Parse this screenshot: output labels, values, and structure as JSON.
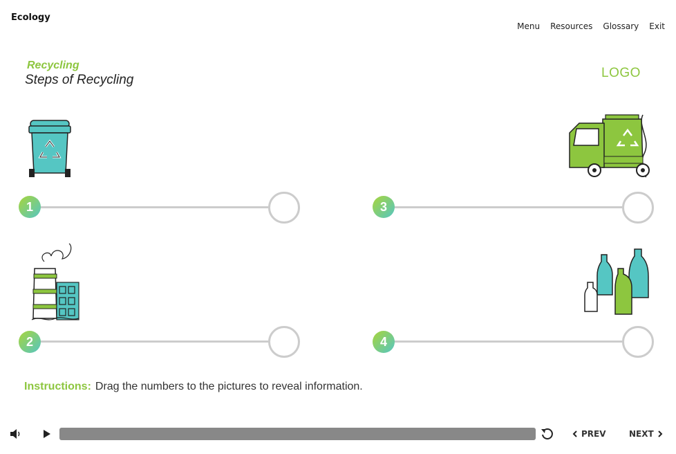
{
  "header": {
    "course_title": "Ecology",
    "nav": [
      "Menu",
      "Resources",
      "Glossary",
      "Exit"
    ]
  },
  "slide": {
    "kicker": "Recycling",
    "title": "Steps of Recycling",
    "logo": "LOGO"
  },
  "steps": [
    {
      "number": "1",
      "icon": "recycling-bin-icon"
    },
    {
      "number": "2",
      "icon": "factory-icon"
    },
    {
      "number": "3",
      "icon": "garbage-truck-icon"
    },
    {
      "number": "4",
      "icon": "bottles-icon"
    }
  ],
  "instructions": {
    "label": "Instructions:",
    "text": "Drag the numbers to the pictures to reveal information."
  },
  "player": {
    "prev": "PREV",
    "next": "NEXT"
  },
  "colors": {
    "accent": "#8dc63f",
    "teal": "#55c6c3",
    "track": "#cccccc",
    "progress": "#888888"
  }
}
